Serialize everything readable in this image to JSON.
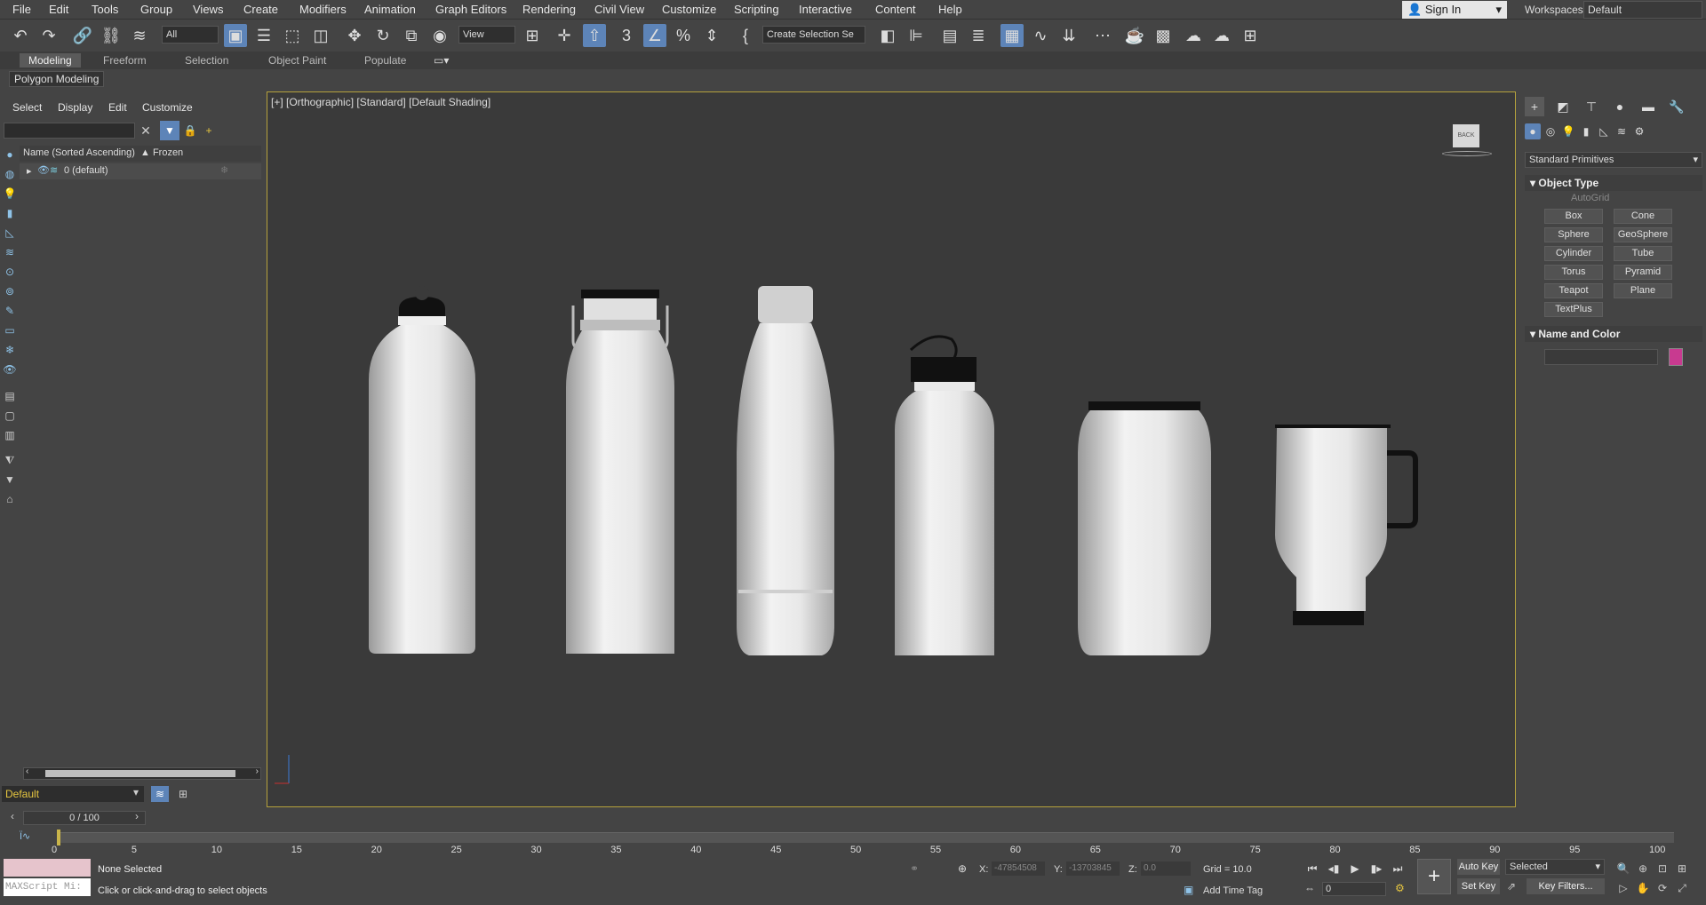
{
  "menu": [
    "File",
    "Edit",
    "Tools",
    "Group",
    "Views",
    "Create",
    "Modifiers",
    "Animation",
    "Graph Editors",
    "Rendering",
    "Civil View",
    "Customize",
    "Scripting",
    "Interactive",
    "Content",
    "Help"
  ],
  "signin": "Sign In",
  "workspace": {
    "label": "Workspaces:",
    "value": "Default"
  },
  "toolbar": {
    "filter": "All",
    "view": "View",
    "selection_set": "Create Selection Se"
  },
  "ribbon": {
    "tabs": [
      "Modeling",
      "Freeform",
      "Selection",
      "Object Paint",
      "Populate"
    ],
    "sub": "Polygon Modeling"
  },
  "scene": {
    "menu": [
      "Select",
      "Display",
      "Edit",
      "Customize"
    ],
    "col_name": "Name (Sorted Ascending)",
    "col_frozen": "▲ Frozen",
    "row": "0 (default)"
  },
  "layer": "Default",
  "viewport": {
    "label": "[+] [Orthographic] [Standard] [Default Shading]",
    "viewcube": "BACK"
  },
  "command": {
    "category": "Standard Primitives",
    "object_type": "Object Type",
    "autogrid": "AutoGrid",
    "primitives": [
      "Box",
      "Cone",
      "Sphere",
      "GeoSphere",
      "Cylinder",
      "Tube",
      "Torus",
      "Pyramid",
      "Teapot",
      "Plane",
      "TextPlus"
    ],
    "name_color": "Name and Color",
    "swatch_color": "#c83a90"
  },
  "time": {
    "slider": "0 / 100",
    "ticks": [
      "0",
      "5",
      "10",
      "15",
      "20",
      "25",
      "30",
      "35",
      "40",
      "45",
      "50",
      "55",
      "60",
      "65",
      "70",
      "75",
      "80",
      "85",
      "90",
      "95",
      "100"
    ]
  },
  "status": {
    "listener": "MAXScript Mi:",
    "selected": "None Selected",
    "prompt": "Click or click-and-drag to select objects",
    "x": "-47854508",
    "y": "-13703845",
    "z": "0.0",
    "grid": "Grid = 10.0",
    "time_tag": "Add Time Tag",
    "auto_key": "Auto Key",
    "set_key": "Set Key",
    "key_mode": "Selected",
    "key_filters": "Key Filters...",
    "frame": "0"
  }
}
